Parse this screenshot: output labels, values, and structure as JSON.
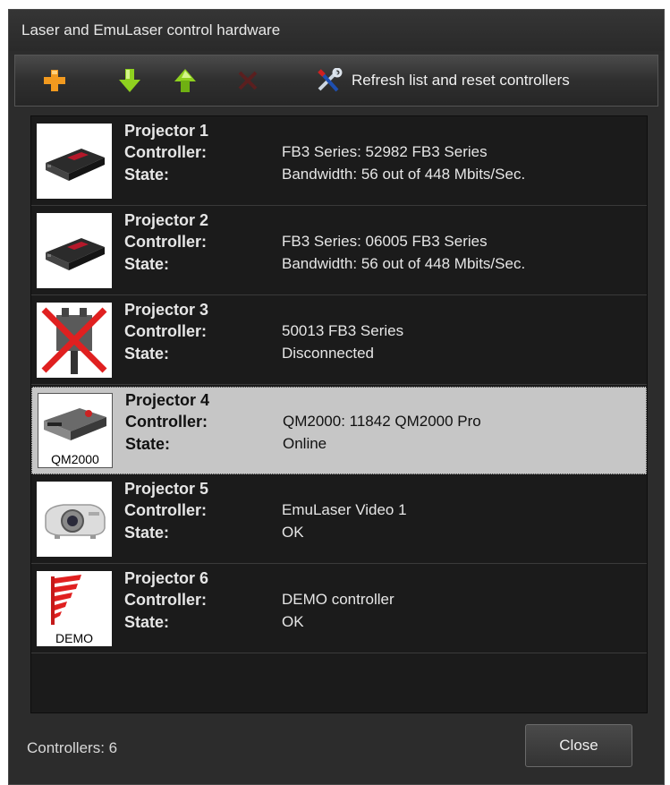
{
  "window": {
    "title": "Laser and EmuLaser control hardware"
  },
  "toolbar": {
    "add_icon": "plus-icon",
    "down_icon": "arrow-down-icon",
    "up_icon": "arrow-up-icon",
    "delete_icon": "x-icon",
    "refresh_label": "Refresh list and reset controllers",
    "refresh_icon": "tools-icon"
  },
  "projectors": [
    {
      "name": "Projector 1",
      "controller_label": "Controller:",
      "controller": "FB3 Series: 52982 FB3 Series",
      "state_label": "State:",
      "state": "Bandwidth: 56 out of 448 Mbits/Sec.",
      "icon": "fb3-device-icon",
      "thumb_label": ""
    },
    {
      "name": "Projector 2",
      "controller_label": "Controller:",
      "controller": "FB3 Series: 06005 FB3 Series",
      "state_label": "State:",
      "state": "Bandwidth: 56 out of 448 Mbits/Sec.",
      "icon": "fb3-device-icon",
      "thumb_label": ""
    },
    {
      "name": "Projector 3",
      "controller_label": "Controller:",
      "controller": "50013 FB3 Series",
      "state_label": "State:",
      "state": "Disconnected",
      "icon": "disconnected-plug-icon",
      "thumb_label": ""
    },
    {
      "name": "Projector 4",
      "controller_label": "Controller:",
      "controller": "QM2000: 11842 QM2000 Pro",
      "state_label": "State:",
      "state": "Online",
      "icon": "qm2000-device-icon",
      "thumb_label": "QM2000",
      "selected": true
    },
    {
      "name": "Projector 5",
      "controller_label": "Controller:",
      "controller": "EmuLaser Video 1",
      "state_label": "State:",
      "state": "OK",
      "icon": "video-projector-icon",
      "thumb_label": ""
    },
    {
      "name": "Projector 6",
      "controller_label": "Controller:",
      "controller": "DEMO controller",
      "state_label": "State:",
      "state": "OK",
      "icon": "demo-flag-icon",
      "thumb_label": "DEMO"
    }
  ],
  "footer": {
    "controllers_count": "Controllers: 6",
    "close_label": "Close"
  },
  "colors": {
    "background": "#2c2c2c",
    "list_bg": "#1b1b1b",
    "selected_row": "#c6c6c6",
    "add": "#f29a1f",
    "arrows": "#8fd11f",
    "delete_disabled": "#5a1f1f"
  }
}
